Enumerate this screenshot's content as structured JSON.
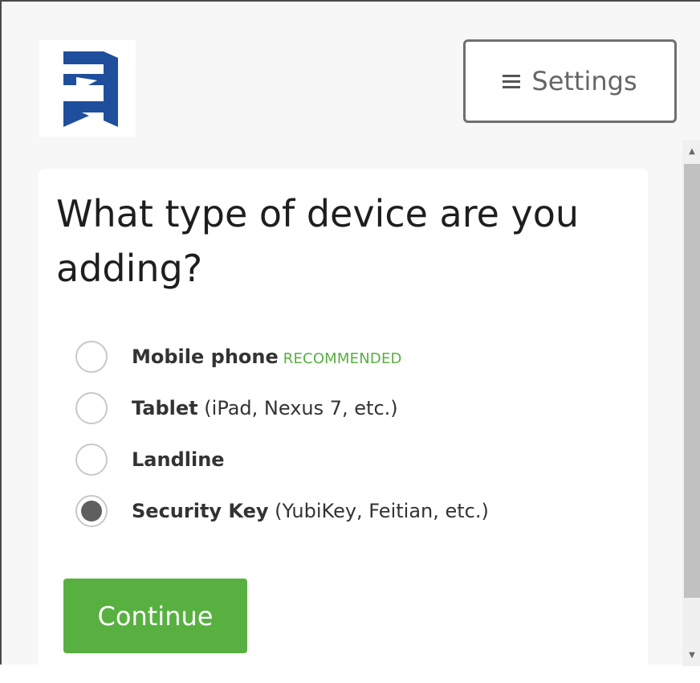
{
  "header": {
    "logo_icon": "brand-logo",
    "settings_label": "Settings",
    "settings_icon": "hamburger-menu-icon"
  },
  "form": {
    "question": "What type of device are you adding?",
    "options": [
      {
        "label": "Mobile phone",
        "note": "",
        "tag": "RECOMMENDED",
        "selected": false
      },
      {
        "label": "Tablet",
        "note": "(iPad, Nexus 7, etc.)",
        "tag": "",
        "selected": false
      },
      {
        "label": "Landline",
        "note": "",
        "tag": "",
        "selected": false
      },
      {
        "label": "Security Key",
        "note": "(YubiKey, Feitian, etc.)",
        "tag": "",
        "selected": true
      }
    ],
    "continue_label": "Continue"
  },
  "colors": {
    "brand_blue": "#1f4e9c",
    "accent_green": "#58b041",
    "recommended_green": "#5aad43"
  }
}
